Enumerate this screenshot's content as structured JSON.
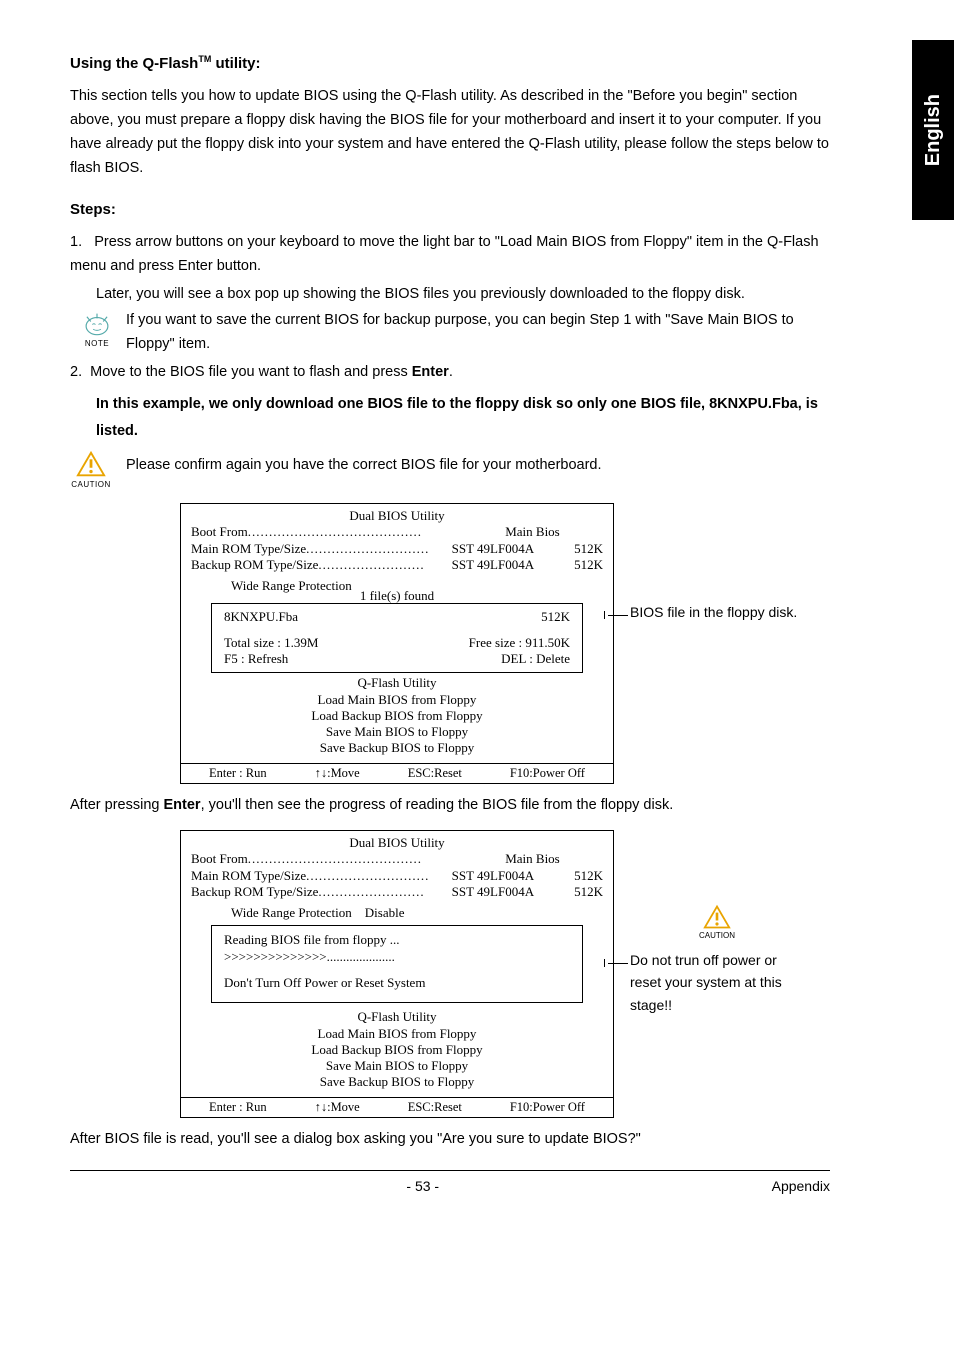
{
  "sideTab": "English",
  "heading1_prefix": "Using the Q-Flash",
  "heading1_tm": "TM",
  "heading1_suffix": " utility:",
  "intro": "This section tells you how to update BIOS using the Q-Flash utility. As described in the \"Before you begin\" section above, you must prepare a floppy disk having the BIOS file for your motherboard and insert it to your computer. If you have already put the floppy disk into your system and have entered the Q-Flash utility, please follow the steps below to flash BIOS.",
  "stepsHeading": "Steps:",
  "step1_num": "1.",
  "step1a": "Press arrow buttons on your keyboard to move the light bar to \"Load Main BIOS from Floppy\" item in the Q-Flash menu and press Enter button.",
  "step1b": "Later, you will see a box pop up showing the BIOS files you previously downloaded to the floppy disk.",
  "noteLabel": "NOTE",
  "noteText": "If you want to save the current BIOS for backup purpose, you can begin Step 1 with \"Save Main BIOS to Floppy\" item.",
  "step2_num": "2.",
  "step2a_before": "Move to the BIOS file you want to flash and press ",
  "step2a_bold": "Enter",
  "step2a_after": ".",
  "step2b": "In this example, we only download one BIOS file to the floppy disk so only one BIOS file, 8KNXPU.Fba, is listed.",
  "cautionLabel": "CAUTION",
  "cautionText": "Please confirm again you have the correct BIOS file for your motherboard.",
  "bios": {
    "title": "Dual BIOS Utility",
    "bootFromLabel": "Boot From",
    "bootFromVal": "Main Bios",
    "mainRomLabel": "Main ROM Type/Size",
    "mainRomVal": "SST 49LF004A",
    "mainRomSize": "512K",
    "backupRomLabel": "Backup ROM Type/Size",
    "backupRomVal": "SST 49LF004A",
    "backupRomSize": "512K",
    "wideRange": "Wide Range Protection",
    "wideRangeVal": "Disable",
    "filesFound": "1 file(s) found",
    "fileName": "8KNXPU.Fba",
    "fileSize": "512K",
    "totalSize": "Total size : 1.39M",
    "freeSize": "Free size : 911.50K",
    "f5": "F5 : Refresh",
    "del": "DEL : Delete",
    "qfTitle": "Q-Flash Utility",
    "items": [
      "Load Main BIOS from Floppy",
      "Load Backup BIOS from Floppy",
      "Save Main BIOS to Floppy",
      "Save Backup BIOS to Floppy"
    ],
    "footer": {
      "enter": "Enter : Run",
      "move": "↑↓:Move",
      "esc": "ESC:Reset",
      "f10": "F10:Power Off"
    },
    "reading": "Reading BIOS file from floppy ...",
    "progress": ">>>>>>>>>>>>>>.....................",
    "dontTurnOff": "Don't Turn Off Power or Reset System"
  },
  "callout1": "BIOS file in the floppy disk.",
  "afterEnter_before": "After pressing ",
  "afterEnter_bold": "Enter",
  "afterEnter_after": ", you'll then see the progress of reading the BIOS file from the floppy disk.",
  "callout2": "Do not trun off power or reset your system at this stage!!",
  "afterRead": "After BIOS file is read, you'll see a  dialog box asking you \"Are you sure to update BIOS?\"",
  "pageNum": "- 53 -",
  "appendix": "Appendix"
}
